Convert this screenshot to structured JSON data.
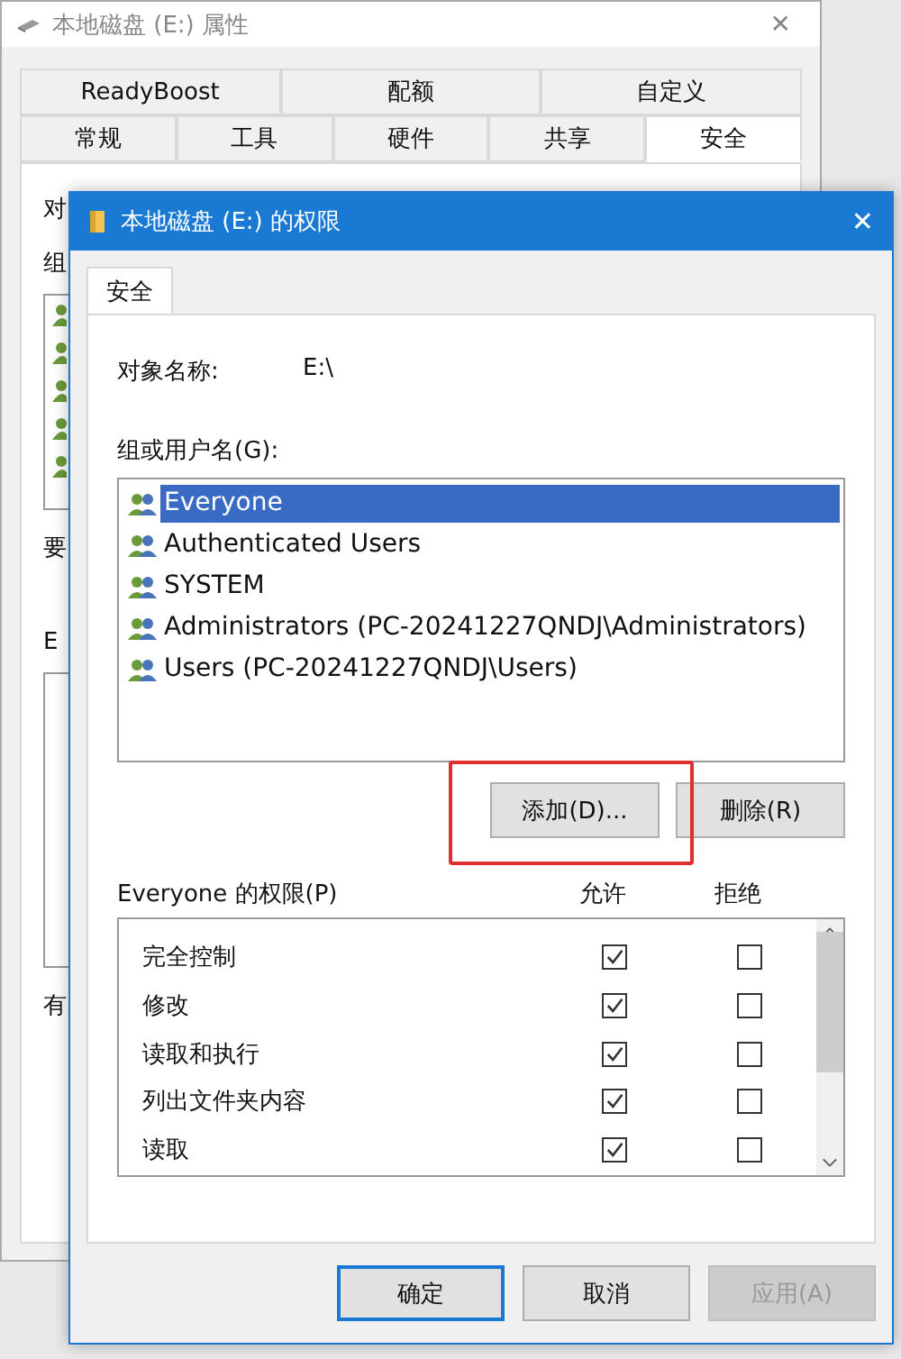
{
  "background_window": {
    "title": "本地磁盘 (E:) 属性",
    "close": "✕",
    "tabs_top": [
      {
        "label": "ReadyBoost",
        "selected": false
      },
      {
        "label": "配额",
        "selected": false
      },
      {
        "label": "自定义",
        "selected": false
      }
    ],
    "tabs_bottom": [
      {
        "label": "常规",
        "selected": false
      },
      {
        "label": "工具",
        "selected": false
      },
      {
        "label": "硬件",
        "selected": false
      },
      {
        "label": "共享",
        "selected": false
      },
      {
        "label": "安全",
        "selected": true
      }
    ],
    "fragments": [
      "对",
      "组",
      "要",
      "E",
      "有"
    ]
  },
  "dialog": {
    "title": "本地磁盘 (E:) 的权限",
    "close": "✕",
    "tab": {
      "label": "安全",
      "selected": true
    },
    "object_label": "对象名称:",
    "object_value": "E:\\",
    "users_label": "组或用户名(G):",
    "users": [
      {
        "name": "Everyone",
        "selected": true
      },
      {
        "name": "Authenticated Users",
        "selected": false
      },
      {
        "name": "SYSTEM",
        "selected": false
      },
      {
        "name": "Administrators (PC-20241227QNDJ\\Administrators)",
        "selected": false
      },
      {
        "name": "Users (PC-20241227QNDJ\\Users)",
        "selected": false
      }
    ],
    "add_button": "添加(D)...",
    "remove_button": "删除(R)",
    "permissions_label": "Everyone 的权限(P)",
    "allow_header": "允许",
    "deny_header": "拒绝",
    "permissions": [
      {
        "name": "完全控制",
        "allow": true,
        "deny": false
      },
      {
        "name": "修改",
        "allow": true,
        "deny": false
      },
      {
        "name": "读取和执行",
        "allow": true,
        "deny": false
      },
      {
        "name": "列出文件夹内容",
        "allow": true,
        "deny": false
      },
      {
        "name": "读取",
        "allow": true,
        "deny": false
      }
    ],
    "buttons": [
      {
        "label": "确定",
        "default": true,
        "disabled": false
      },
      {
        "label": "取消",
        "default": false,
        "disabled": false
      },
      {
        "label": "应用(A)",
        "default": false,
        "disabled": true
      }
    ]
  }
}
